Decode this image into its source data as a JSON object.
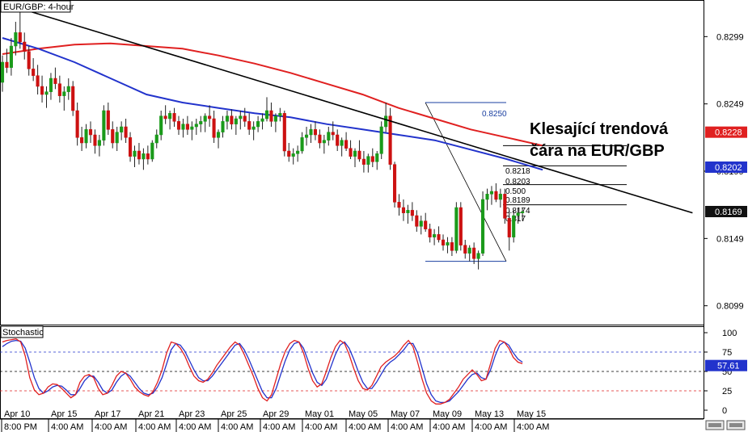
{
  "chart_title": "EUR/GBP: 4-hour",
  "annotation": "Klesající trendová\nčára na EUR/GBP",
  "indicator_label": "Stochastic",
  "colors": {
    "bull": "#1a9a1a",
    "bear": "#cc1111",
    "ma_red": "#e02020",
    "ma_blue": "#2233cc",
    "trendline": "#000000",
    "fib": "#1a3fa0",
    "stoch_k": "#e02020",
    "stoch_d": "#2233cc",
    "stoch_level_blue": "#2233cc",
    "stoch_level_red": "#e02020",
    "price_badge_dark": "#111111",
    "price_badge_red": "#e02020",
    "price_badge_blue": "#2233cc"
  },
  "price_axis": {
    "ticks": [
      "0.8299",
      "0.8249",
      "0.8199",
      "0.8149",
      "0.8099"
    ],
    "tick_values": [
      0.8299,
      0.8249,
      0.8199,
      0.8149,
      0.8099
    ]
  },
  "price_badges": [
    {
      "text": "0.8228",
      "value": 0.8228,
      "color_key": "price_badge_red"
    },
    {
      "text": "0.8202",
      "value": 0.8202,
      "color_key": "price_badge_blue"
    },
    {
      "text": "0.8169",
      "value": 0.8169,
      "color_key": "price_badge_dark"
    }
  ],
  "fib_labels": [
    {
      "text": "0.8250"
    },
    {
      "text": "0.8218"
    },
    {
      "text": "0.8203"
    },
    {
      "text": "0.500"
    },
    {
      "text": "0.8189"
    },
    {
      "text": "0.8174"
    },
    {
      "text": "0.817"
    }
  ],
  "stoch_axis": {
    "ticks": [
      "100",
      "75",
      "50",
      "25",
      "0"
    ],
    "tick_values": [
      100,
      75,
      50,
      25,
      0
    ],
    "badge": "57.61",
    "badge_value": 57.61
  },
  "x_axis": {
    "top_labels": [
      "Apr 10",
      "Apr 15",
      "Apr 17",
      "Apr 21",
      "Apr 23",
      "Apr 25",
      "Apr 29",
      "May 01",
      "May 05",
      "May 07",
      "May 09",
      "May 13",
      "May 15"
    ],
    "bottom_labels": [
      "8:00 PM",
      "4:00 AM",
      "4:00 AM",
      "4:00 AM",
      "4:00 AM",
      "4:00 AM",
      "4:00 AM",
      "4:00 AM",
      "4:00 AM",
      "4:00 AM",
      "4:00 AM",
      "4:00 AM",
      "4:00 AM"
    ]
  },
  "chart_data": {
    "type": "candlestick",
    "title": "EUR/GBP: 4-hour",
    "ylim": [
      0.8085,
      0.8325
    ],
    "candles_ohlc": [
      [
        0.8265,
        0.8285,
        0.8258,
        0.828
      ],
      [
        0.828,
        0.829,
        0.8272,
        0.8276
      ],
      [
        0.8276,
        0.8298,
        0.827,
        0.8292
      ],
      [
        0.8292,
        0.831,
        0.8285,
        0.8302
      ],
      [
        0.8302,
        0.8318,
        0.829,
        0.8295
      ],
      [
        0.8295,
        0.8302,
        0.8282,
        0.8288
      ],
      [
        0.8288,
        0.8292,
        0.827,
        0.8275
      ],
      [
        0.8275,
        0.8283,
        0.8266,
        0.827
      ],
      [
        0.827,
        0.8278,
        0.8256,
        0.8262
      ],
      [
        0.8262,
        0.827,
        0.825,
        0.8256
      ],
      [
        0.8256,
        0.8262,
        0.8246,
        0.8258
      ],
      [
        0.8258,
        0.8272,
        0.8252,
        0.8268
      ],
      [
        0.8268,
        0.8276,
        0.826,
        0.8264
      ],
      [
        0.8264,
        0.827,
        0.825,
        0.8255
      ],
      [
        0.8255,
        0.8262,
        0.8244,
        0.8258
      ],
      [
        0.8258,
        0.8268,
        0.8252,
        0.8262
      ],
      [
        0.8262,
        0.8266,
        0.824,
        0.8244
      ],
      [
        0.8244,
        0.825,
        0.8218,
        0.8224
      ],
      [
        0.8224,
        0.8232,
        0.8214,
        0.822
      ],
      [
        0.822,
        0.8234,
        0.8216,
        0.823
      ],
      [
        0.823,
        0.8236,
        0.822,
        0.8226
      ],
      [
        0.8226,
        0.823,
        0.8212,
        0.8218
      ],
      [
        0.8218,
        0.8226,
        0.821,
        0.8222
      ],
      [
        0.8222,
        0.8248,
        0.8218,
        0.8244
      ],
      [
        0.8244,
        0.825,
        0.8226,
        0.823
      ],
      [
        0.823,
        0.8236,
        0.8216,
        0.822
      ],
      [
        0.822,
        0.8232,
        0.8214,
        0.8228
      ],
      [
        0.8228,
        0.8236,
        0.8222,
        0.8232
      ],
      [
        0.8232,
        0.8238,
        0.822,
        0.8224
      ],
      [
        0.8224,
        0.8228,
        0.8206,
        0.821
      ],
      [
        0.821,
        0.8218,
        0.8202,
        0.8214
      ],
      [
        0.8214,
        0.822,
        0.8204,
        0.8208
      ],
      [
        0.8208,
        0.8216,
        0.82,
        0.8212
      ],
      [
        0.8212,
        0.8218,
        0.8204,
        0.8208
      ],
      [
        0.8208,
        0.8222,
        0.8206,
        0.822
      ],
      [
        0.822,
        0.823,
        0.8216,
        0.8226
      ],
      [
        0.8226,
        0.8244,
        0.8222,
        0.824
      ],
      [
        0.824,
        0.8248,
        0.8234,
        0.8238
      ],
      [
        0.8238,
        0.8244,
        0.823,
        0.8242
      ],
      [
        0.8242,
        0.8246,
        0.8232,
        0.8236
      ],
      [
        0.8236,
        0.824,
        0.8226,
        0.823
      ],
      [
        0.823,
        0.8238,
        0.8224,
        0.8234
      ],
      [
        0.8234,
        0.824,
        0.8226,
        0.823
      ],
      [
        0.823,
        0.8236,
        0.8222,
        0.8232
      ],
      [
        0.8232,
        0.8238,
        0.8226,
        0.8234
      ],
      [
        0.8234,
        0.824,
        0.8228,
        0.8236
      ],
      [
        0.8236,
        0.8242,
        0.8228,
        0.824
      ],
      [
        0.824,
        0.8248,
        0.8232,
        0.8238
      ],
      [
        0.8238,
        0.8244,
        0.822,
        0.8224
      ],
      [
        0.8224,
        0.823,
        0.8216,
        0.8228
      ],
      [
        0.8228,
        0.824,
        0.8224,
        0.8236
      ],
      [
        0.8236,
        0.8244,
        0.823,
        0.824
      ],
      [
        0.824,
        0.8245,
        0.823,
        0.8234
      ],
      [
        0.8234,
        0.824,
        0.8226,
        0.8238
      ],
      [
        0.8238,
        0.8244,
        0.823,
        0.824
      ],
      [
        0.824,
        0.8246,
        0.8232,
        0.8236
      ],
      [
        0.8236,
        0.8242,
        0.8226,
        0.823
      ],
      [
        0.823,
        0.8236,
        0.8222,
        0.8232
      ],
      [
        0.8232,
        0.824,
        0.8228,
        0.8236
      ],
      [
        0.8236,
        0.8242,
        0.823,
        0.8238
      ],
      [
        0.8238,
        0.8254,
        0.8236,
        0.8244
      ],
      [
        0.8244,
        0.825,
        0.8232,
        0.8236
      ],
      [
        0.8236,
        0.8242,
        0.8228,
        0.824
      ],
      [
        0.824,
        0.8246,
        0.8236,
        0.8242
      ],
      [
        0.8242,
        0.8244,
        0.821,
        0.8214
      ],
      [
        0.8214,
        0.822,
        0.8206,
        0.821
      ],
      [
        0.821,
        0.8216,
        0.8204,
        0.8212
      ],
      [
        0.8212,
        0.8218,
        0.8206,
        0.8214
      ],
      [
        0.8214,
        0.8228,
        0.8212,
        0.8224
      ],
      [
        0.8224,
        0.8232,
        0.8218,
        0.8226
      ],
      [
        0.8226,
        0.8234,
        0.822,
        0.823
      ],
      [
        0.823,
        0.8236,
        0.8222,
        0.8226
      ],
      [
        0.8226,
        0.823,
        0.8216,
        0.822
      ],
      [
        0.822,
        0.8226,
        0.8212,
        0.8222
      ],
      [
        0.8222,
        0.8232,
        0.8218,
        0.8228
      ],
      [
        0.8228,
        0.8236,
        0.8222,
        0.8226
      ],
      [
        0.8226,
        0.823,
        0.8214,
        0.8218
      ],
      [
        0.8218,
        0.8224,
        0.821,
        0.8222
      ],
      [
        0.8222,
        0.8228,
        0.8214,
        0.8216
      ],
      [
        0.8216,
        0.8222,
        0.8208,
        0.821
      ],
      [
        0.821,
        0.8216,
        0.8202,
        0.8214
      ],
      [
        0.8214,
        0.8222,
        0.8206,
        0.8208
      ],
      [
        0.8208,
        0.8214,
        0.8198,
        0.8204
      ],
      [
        0.8204,
        0.8212,
        0.8198,
        0.821
      ],
      [
        0.821,
        0.8216,
        0.8202,
        0.8206
      ],
      [
        0.8206,
        0.8214,
        0.82,
        0.8212
      ],
      [
        0.8212,
        0.8236,
        0.8208,
        0.8232
      ],
      [
        0.8232,
        0.825,
        0.8228,
        0.824
      ],
      [
        0.824,
        0.8246,
        0.82,
        0.8204
      ],
      [
        0.8204,
        0.8206,
        0.8172,
        0.8176
      ],
      [
        0.8176,
        0.8182,
        0.8166,
        0.8172
      ],
      [
        0.8172,
        0.8178,
        0.8162,
        0.8168
      ],
      [
        0.8168,
        0.8174,
        0.816,
        0.817
      ],
      [
        0.817,
        0.8176,
        0.8162,
        0.8166
      ],
      [
        0.8166,
        0.817,
        0.8154,
        0.8158
      ],
      [
        0.8158,
        0.8166,
        0.8152,
        0.8162
      ],
      [
        0.8162,
        0.8168,
        0.8154,
        0.8156
      ],
      [
        0.8156,
        0.816,
        0.8146,
        0.815
      ],
      [
        0.815,
        0.8156,
        0.8144,
        0.8152
      ],
      [
        0.8152,
        0.8158,
        0.8146,
        0.8148
      ],
      [
        0.8148,
        0.8152,
        0.814,
        0.8144
      ],
      [
        0.8144,
        0.815,
        0.8138,
        0.8146
      ],
      [
        0.8146,
        0.815,
        0.8136,
        0.814
      ],
      [
        0.814,
        0.8176,
        0.8138,
        0.8172
      ],
      [
        0.8172,
        0.8176,
        0.814,
        0.8144
      ],
      [
        0.8144,
        0.8148,
        0.8134,
        0.8138
      ],
      [
        0.8138,
        0.8144,
        0.8132,
        0.8142
      ],
      [
        0.8142,
        0.8146,
        0.813,
        0.8134
      ],
      [
        0.8134,
        0.814,
        0.8126,
        0.8138
      ],
      [
        0.8138,
        0.8184,
        0.8136,
        0.8178
      ],
      [
        0.8178,
        0.8186,
        0.817,
        0.8182
      ],
      [
        0.8182,
        0.8188,
        0.8174,
        0.8184
      ],
      [
        0.8184,
        0.819,
        0.8176,
        0.8178
      ],
      [
        0.8178,
        0.8186,
        0.8172,
        0.8182
      ],
      [
        0.8182,
        0.8186,
        0.816,
        0.8164
      ],
      [
        0.8164,
        0.817,
        0.814,
        0.815
      ],
      [
        0.815,
        0.817,
        0.8146,
        0.8166
      ],
      [
        0.8166,
        0.8172,
        0.816,
        0.8168
      ],
      [
        0.8168,
        0.8172,
        0.8162,
        0.8169
      ]
    ],
    "ma_red": [
      0.8286,
      0.829,
      0.8293,
      0.8294,
      0.8292,
      0.829,
      0.8285,
      0.8279,
      0.8272,
      0.8264,
      0.8256,
      0.8246,
      0.8238,
      0.823,
      0.8224,
      0.8218
    ],
    "ma_blue": [
      0.8298,
      0.829,
      0.828,
      0.8268,
      0.8256,
      0.825,
      0.8246,
      0.8242,
      0.8239,
      0.8234,
      0.823,
      0.8226,
      0.8222,
      0.8215,
      0.8208,
      0.82
    ],
    "trendline": {
      "from": [
        0,
        0.8319
      ],
      "to": [
        132,
        0.8168
      ]
    },
    "fib_retracement": {
      "high": 0.825,
      "low": 0.8132,
      "levels": [
        0.825,
        0.8218,
        0.8203,
        0.8189,
        0.8174,
        0.8132
      ]
    },
    "stochastic": {
      "k": [
        88,
        90,
        91,
        92,
        88,
        70,
        42,
        26,
        20,
        22,
        30,
        34,
        33,
        28,
        22,
        16,
        20,
        36,
        44,
        46,
        42,
        28,
        20,
        22,
        32,
        44,
        50,
        48,
        40,
        30,
        24,
        20,
        18,
        24,
        36,
        52,
        74,
        88,
        86,
        80,
        70,
        56,
        44,
        38,
        36,
        40,
        48,
        58,
        66,
        74,
        82,
        88,
        84,
        72,
        58,
        44,
        28,
        16,
        12,
        20,
        40,
        60,
        76,
        86,
        90,
        88,
        74,
        54,
        38,
        30,
        34,
        50,
        68,
        82,
        90,
        86,
        72,
        54,
        38,
        28,
        26,
        32,
        44,
        56,
        62,
        66,
        70,
        76,
        84,
        90,
        82,
        62,
        40,
        22,
        12,
        8,
        8,
        10,
        14,
        22,
        30,
        40,
        46,
        52,
        46,
        38,
        40,
        60,
        80,
        90,
        88,
        80,
        68,
        62,
        60
      ],
      "d": [
        82,
        86,
        89,
        90,
        89,
        80,
        62,
        42,
        28,
        22,
        25,
        30,
        32,
        31,
        26,
        20,
        20,
        28,
        38,
        44,
        44,
        36,
        26,
        22,
        26,
        36,
        44,
        48,
        44,
        36,
        28,
        22,
        20,
        22,
        30,
        42,
        60,
        78,
        86,
        84,
        76,
        64,
        52,
        42,
        38,
        38,
        44,
        52,
        60,
        68,
        76,
        84,
        86,
        78,
        66,
        52,
        38,
        24,
        16,
        16,
        28,
        46,
        64,
        78,
        86,
        88,
        80,
        64,
        48,
        36,
        32,
        40,
        56,
        72,
        84,
        88,
        80,
        66,
        50,
        36,
        28,
        28,
        36,
        46,
        56,
        62,
        66,
        72,
        78,
        86,
        86,
        74,
        54,
        34,
        20,
        12,
        10,
        10,
        12,
        18,
        24,
        32,
        40,
        46,
        48,
        42,
        40,
        52,
        70,
        84,
        88,
        84,
        74,
        66,
        62
      ],
      "levels": [
        75,
        50,
        25
      ]
    }
  }
}
